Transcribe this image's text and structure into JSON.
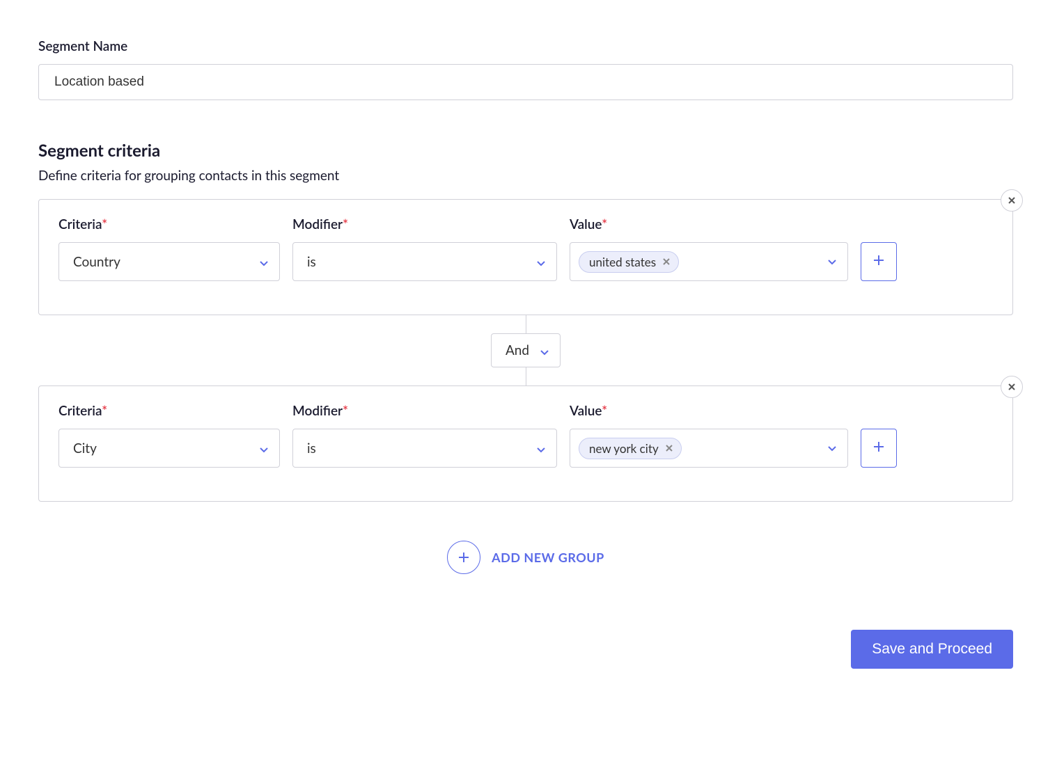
{
  "segmentName": {
    "label": "Segment Name",
    "value": "Location based"
  },
  "criteriaSection": {
    "heading": "Segment criteria",
    "description": "Define criteria for grouping contacts in this segment"
  },
  "labels": {
    "criteria": "Criteria",
    "modifier": "Modifier",
    "value": "Value"
  },
  "groups": [
    {
      "criteria": "Country",
      "modifier": "is",
      "values": [
        "united states"
      ]
    },
    {
      "criteria": "City",
      "modifier": "is",
      "values": [
        "new york city"
      ]
    }
  ],
  "connector": "And",
  "addNewGroupLabel": "ADD NEW GROUP",
  "saveButton": "Save and Proceed"
}
